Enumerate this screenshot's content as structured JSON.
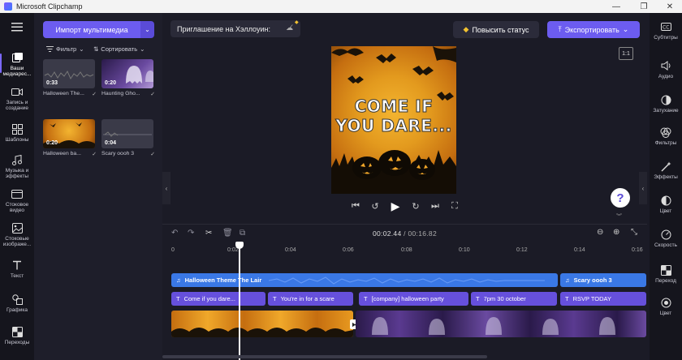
{
  "window": {
    "title": "Microsoft Clipchamp",
    "controls": [
      "—",
      "❐",
      "✕"
    ]
  },
  "left_nav": [
    {
      "label": "Ваши медиарес...",
      "icon": "media-icon",
      "active": true
    },
    {
      "label": "Запись и создание",
      "icon": "camera-icon"
    },
    {
      "label": "Шаблоны",
      "icon": "templates-icon"
    },
    {
      "label": "Музыка и эффекты",
      "icon": "music-icon"
    },
    {
      "label": "Стоковое видео",
      "icon": "stock-video-icon"
    },
    {
      "label": "Стоковые изображе...",
      "icon": "stock-image-icon"
    },
    {
      "label": "Текст",
      "icon": "text-icon"
    },
    {
      "label": "Графика",
      "icon": "graphics-icon"
    },
    {
      "label": "Переходы",
      "icon": "transitions-icon"
    }
  ],
  "media_panel": {
    "import_label": "Импорт мультимедиа",
    "filter_label": "Фильтр",
    "sort_label": "Сортировать",
    "items": [
      {
        "name": "Halloween The...",
        "duration": "0:33",
        "kind": "audio"
      },
      {
        "name": "Haunting Gho...",
        "duration": "0:20",
        "kind": "ghost"
      },
      {
        "name": "Halloween ba...",
        "duration": "0:20",
        "kind": "pumpkin"
      },
      {
        "name": "Scary oooh 3",
        "duration": "0:04",
        "kind": "audio"
      }
    ]
  },
  "topbar": {
    "project_title": "Приглашение на Хэллоуин:",
    "upgrade_label": "Повысить статус",
    "export_label": "Экспортировать",
    "aspect_ratio": "1:1"
  },
  "preview": {
    "line1": "COME IF",
    "line2": "YOU DARE..."
  },
  "right_bar": [
    {
      "label": "Субтитры",
      "icon": "captions-icon"
    },
    {
      "label": "Аудио",
      "icon": "audio-icon"
    },
    {
      "label": "Затухание",
      "icon": "fade-icon"
    },
    {
      "label": "Фильтры",
      "icon": "filters-icon"
    },
    {
      "label": "Эффекты",
      "icon": "effects-icon"
    },
    {
      "label": "Цвет",
      "icon": "color-icon"
    },
    {
      "label": "Скорость",
      "icon": "speed-icon"
    },
    {
      "label": "Переход",
      "icon": "transition-icon"
    },
    {
      "label": "Цвет",
      "icon": "color2-icon"
    }
  ],
  "timeline": {
    "current_time": "00:02.44",
    "total_time": "/ 00:16.82",
    "ruler": [
      "0",
      "0:02",
      "0:04",
      "0:06",
      "0:08",
      "0:10",
      "0:12",
      "0:14",
      "0:16"
    ],
    "audio_clips": [
      "Halloween Theme The Lair",
      "Scary oooh 3"
    ],
    "text_clips": [
      "Come if you dare...",
      "You're in for a scare",
      "[company] halloween party",
      "7pm 30 october",
      "RSVP TODAY"
    ]
  },
  "help_label": "?"
}
